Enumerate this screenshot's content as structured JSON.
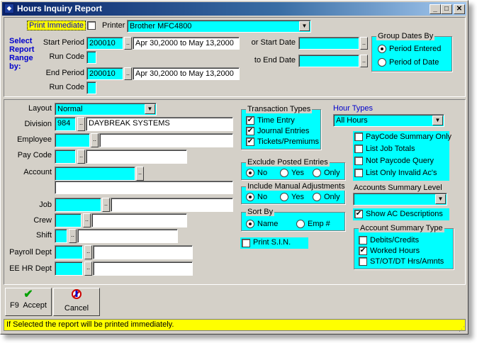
{
  "window": {
    "title": "Hours Inquiry Report",
    "app_icon": "app-icon"
  },
  "top": {
    "print_immediate_label": "Print Immediate",
    "printer_label": "Printer",
    "printer_value": "Brother MFC4800",
    "select_range_label": "Select\nReport\nRange\nby:",
    "start_period_label": "Start Period",
    "start_period_value": "200010",
    "start_period_range": "Apr 30,2000 to May 13,2000",
    "run_code_label": "Run Code",
    "end_period_label": "End Period",
    "end_period_value": "200010",
    "end_period_range": "Apr 30,2000 to May 13,2000",
    "run_code2_label": "Run Code",
    "or_start_date_label": "or Start Date",
    "to_end_date_label": "to End Date",
    "group_dates_title": "Group Dates By",
    "group_dates_options": [
      "Period Entered",
      "Period of Date"
    ]
  },
  "left": {
    "layout_label": "Layout",
    "layout_value": "Normal",
    "division_label": "Division",
    "division_code": "984",
    "division_name": "DAYBREAK SYSTEMS",
    "employee_label": "Employee",
    "pay_code_label": "Pay Code",
    "account_label": "Account",
    "job_label": "Job",
    "crew_label": "Crew",
    "shift_label": "Shift",
    "payroll_dept_label": "Payroll Dept",
    "ee_hr_dept_label": "EE HR Dept"
  },
  "middle": {
    "transaction_types_title": "Transaction Types",
    "transaction_types": [
      "Time Entry",
      "Journal Entries",
      "Tickets/Premiums"
    ],
    "exclude_posted_title": "Exclude Posted Entries",
    "include_manual_title": "Include Manual Adjustments",
    "yes_no_only": [
      "No",
      "Yes",
      "Only"
    ],
    "sort_by_title": "Sort By",
    "sort_by_options": [
      "Name",
      "Emp #"
    ],
    "print_sin_label": "Print S.I.N."
  },
  "right": {
    "hour_types_label": "Hour Types",
    "hour_types_value": "All Hours",
    "options": [
      "PayCode Summary Only",
      "List Job Totals",
      "Not Paycode Query",
      "List Only Invalid Ac's"
    ],
    "accounts_summary_level_label": "Accounts Summary Level",
    "show_ac_descriptions_label": "Show AC Descriptions",
    "account_summary_type_title": "Account Summary Type",
    "account_summary_types": [
      "Debits/Credits",
      "Worked Hours",
      "ST/OT/DT Hrs/Amnts"
    ]
  },
  "buttons": {
    "accept_label": "F9  Accept",
    "cancel_label": "Cancel"
  },
  "status": {
    "text": "If Selected the report will be printed immediately."
  },
  "colors": {
    "field": "#00ffff",
    "status": "#ffff00",
    "label_blue": "#0000cc"
  }
}
